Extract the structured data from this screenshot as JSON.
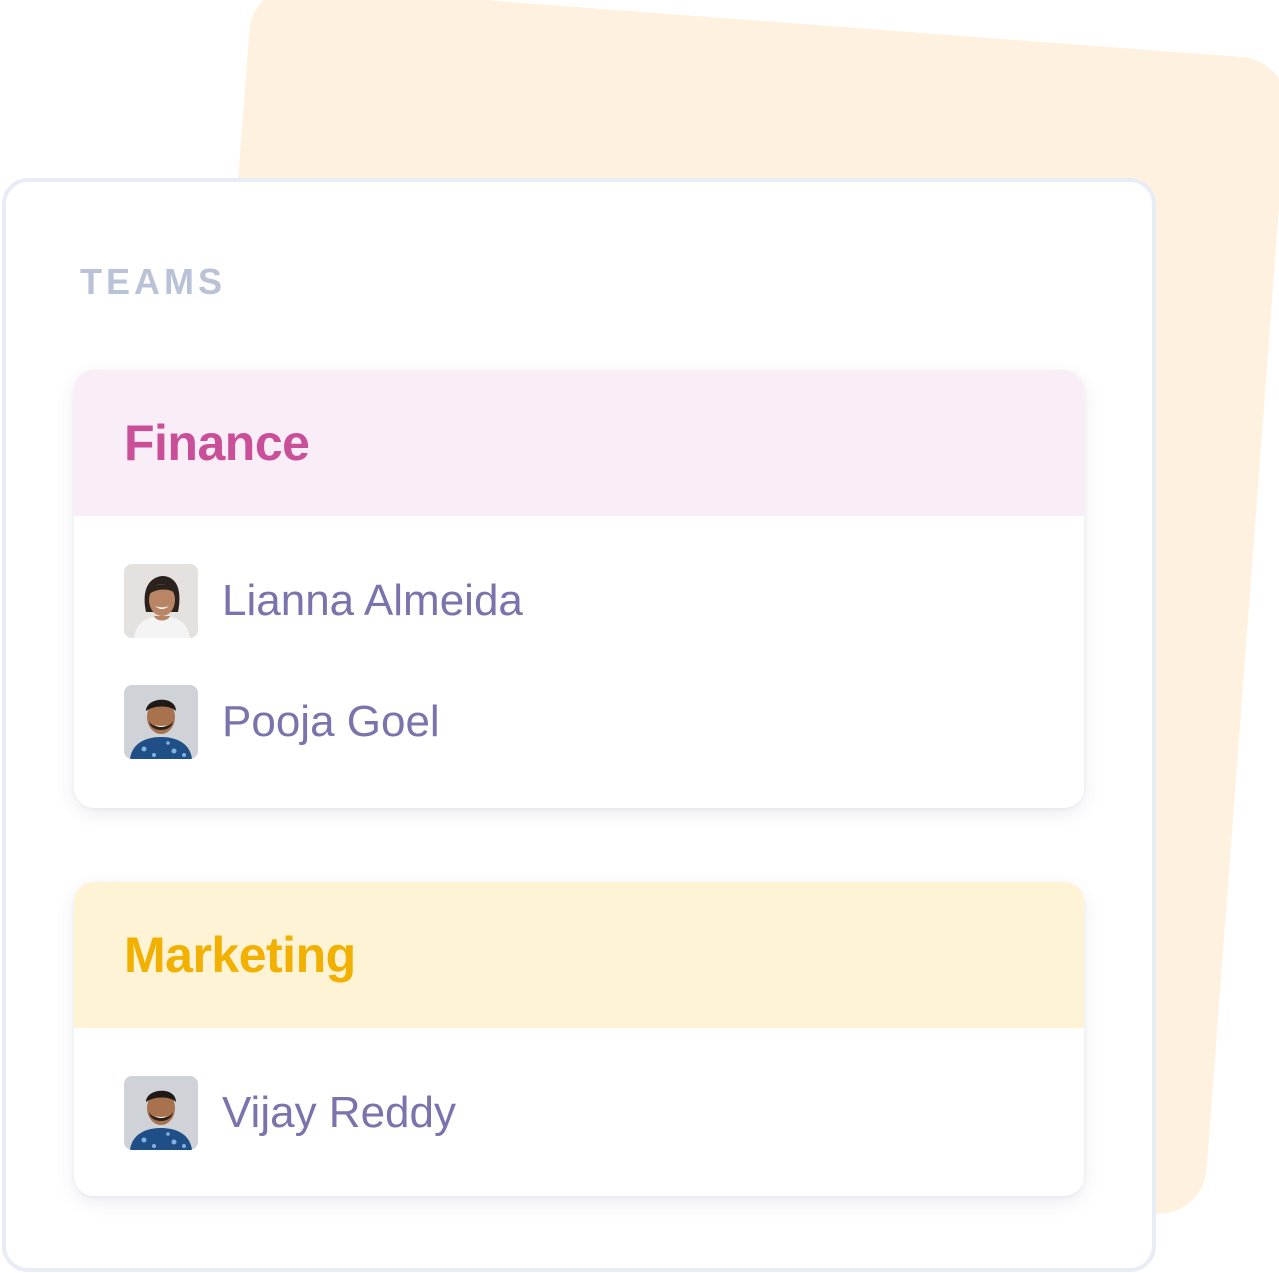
{
  "panel": {
    "title": "TEAMS"
  },
  "teams": [
    {
      "name": "Finance",
      "accent_color": "#c94f98",
      "header_color": "#f9eef8",
      "members": [
        {
          "name": "Lianna Almeida",
          "avatar": "woman-portrait-avatar"
        },
        {
          "name": "Pooja Goel",
          "avatar": "man-portrait-avatar"
        }
      ]
    },
    {
      "name": "Marketing",
      "accent_color": "#f2b100",
      "header_color": "#fff3d6",
      "members": [
        {
          "name": "Vijay Reddy",
          "avatar": "man-portrait-avatar"
        }
      ]
    }
  ],
  "colors": {
    "back_card": "#fff1df",
    "panel_border": "#e8ecf5",
    "title": "#b9c2d6",
    "member_text": "#7b73ac"
  }
}
